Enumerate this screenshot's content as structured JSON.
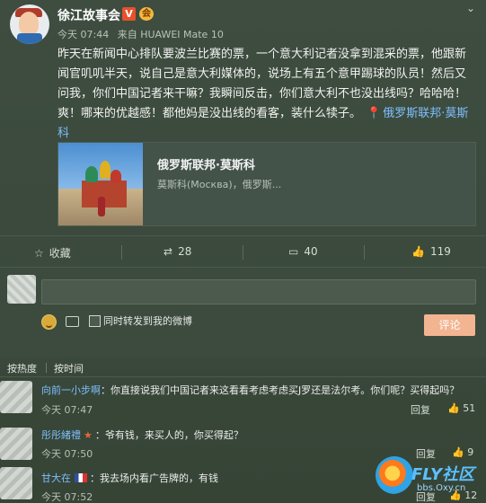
{
  "post": {
    "username": "徐江故事会",
    "vip_badge": "V",
    "badge2": "会",
    "time": "今天 07:44",
    "source": "来自 HUAWEI Mate 10",
    "content_line1": "昨天在新闻中心排队要波兰比赛的票，一个意大利记者没拿到混采的票，他跟新",
    "content_line2": "闻官叽叽半天，说自己是意大利媒体的，说场上有五个意甲踢球的队员！然后又",
    "content_line3": "问我，你们中国记者来干嘛？我瞬间反击，你们意大利不也没出线吗？哈哈哈！",
    "content_line4": "爽！哪来的优越感！都他妈是没出线的看客，装什么犊子。",
    "location_a": "俄罗斯联邦·莫斯",
    "location_b": "科",
    "card": {
      "title": "俄罗斯联邦·莫斯科",
      "subtitle": "莫斯科(Москва)，俄罗斯..."
    }
  },
  "actions": {
    "favorite": "收藏",
    "repost": "28",
    "comment": "40",
    "like": "119"
  },
  "reply_box": {
    "also_repost_label": "同时转发到我的微博",
    "submit_label": "评论"
  },
  "sort": {
    "hot": "按热度",
    "time": "按时间"
  },
  "comments": [
    {
      "name": "向前一小步啊",
      "text": "：你直接说我们中国记者来这看看考虑考虑买J罗还是法尔考。你们呢？买得起吗？",
      "time": "今天 07:47",
      "reply": "回复",
      "likes": "51"
    },
    {
      "name": "彤彤緒禮",
      "text": "：爷有钱，来买人的，你买得起？",
      "time": "今天 07:50",
      "reply": "回复",
      "likes": "9"
    },
    {
      "name": "甘大在",
      "text": "：我去场内看广告牌的，有钱",
      "time": "今天 07:52",
      "reply": "回复",
      "likes": "12"
    }
  ],
  "watermark": {
    "text": "FLY社区",
    "sub": "bbs.Oxy.cn"
  }
}
